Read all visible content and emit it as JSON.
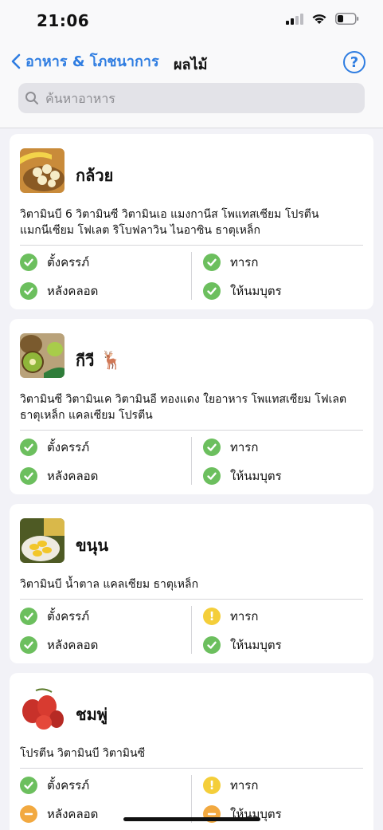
{
  "status": {
    "time": "21:06"
  },
  "nav": {
    "back_label": "อาหาร & โภชนาการ",
    "title": "ผลไม้",
    "help_label": "?"
  },
  "search": {
    "placeholder": "ค้นหาอาหาร"
  },
  "foods": [
    {
      "name": "กล้วย",
      "nutrients": "วิตามินบี 6 วิตามินซี วิตามินเอ แมงกานีส โพแทสเซียม โปรตีน แมกนีเซียม โฟเลต ริโบฟลาวิน ไนอาซิน ธาตุเหล็ก",
      "statuses": [
        {
          "label": "ตั้งครรภ์",
          "level": "ok"
        },
        {
          "label": "ทารก",
          "level": "ok"
        },
        {
          "label": "หลังคลอด",
          "level": "ok"
        },
        {
          "label": "ให้นมบุตร",
          "level": "ok"
        }
      ]
    },
    {
      "name": "กีวี",
      "emoji": "🦌",
      "nutrients": "วิตามินซี วิตามินเค วิตามินอี ทองแดง ใยอาหาร โพแทสเซียม โฟเลต ธาตุเหล็ก แคลเซียม โปรตีน",
      "statuses": [
        {
          "label": "ตั้งครรภ์",
          "level": "ok"
        },
        {
          "label": "ทารก",
          "level": "ok"
        },
        {
          "label": "หลังคลอด",
          "level": "ok"
        },
        {
          "label": "ให้นมบุตร",
          "level": "ok"
        }
      ]
    },
    {
      "name": "ขนุน",
      "nutrients": "วิตามินบี น้ำตาล แคลเซียม ธาตุเหล็ก",
      "statuses": [
        {
          "label": "ตั้งครรภ์",
          "level": "ok"
        },
        {
          "label": "ทารก",
          "level": "warn"
        },
        {
          "label": "หลังคลอด",
          "level": "ok"
        },
        {
          "label": "ให้นมบุตร",
          "level": "ok"
        }
      ]
    },
    {
      "name": "ชมพู่",
      "nutrients": "โปรตีน วิตามินบี วิตามินซี",
      "statuses": [
        {
          "label": "ตั้งครรภ์",
          "level": "ok"
        },
        {
          "label": "ทารก",
          "level": "warn"
        },
        {
          "label": "หลังคลอด",
          "level": "caution"
        },
        {
          "label": "ให้นมบุตร",
          "level": "caution"
        }
      ]
    }
  ],
  "colors": {
    "accent": "#2f7de1",
    "ok": "#6cbf5e",
    "warn": "#f4ce3a",
    "caution": "#f2a940"
  }
}
